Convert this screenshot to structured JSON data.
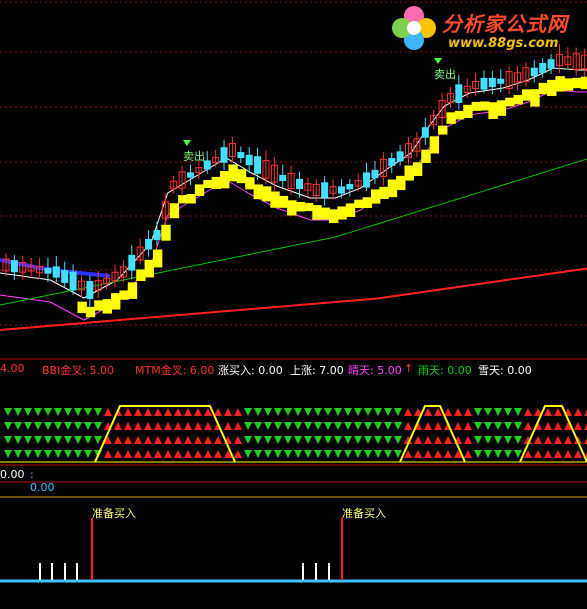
{
  "watermark": {
    "name": "分析家公式网",
    "url": "www.88gs.com"
  },
  "price_panel": {
    "signals": [
      {
        "label": "卖出"
      },
      {
        "label": "卖出"
      }
    ],
    "colors": {
      "up_candle": "#ff3030",
      "down_candle": "#40e0ff",
      "ribbon": "#ffff00",
      "ma_short": "#ffffff",
      "ma_mid": "#ff40ff",
      "ma_long": "#00c000",
      "ma_longest": "#ff2020",
      "blue_line": "#3030ff"
    }
  },
  "indicator_row": [
    {
      "text": "4.00",
      "color": "#ff3030"
    },
    {
      "text": "BBI金叉: 5.00",
      "color": "#ff3030"
    },
    {
      "text": "MTM金叉: 6.00",
      "color": "#ff3030"
    },
    {
      "text": "涨买入: 0.00",
      "color": "#ffffff"
    },
    {
      "text": "上涨: 7.00",
      "color": "#ffffff"
    },
    {
      "text": "晴天: 5.00",
      "color": "#ff40ff"
    },
    {
      "text": "↑",
      "color": "#ff3030"
    },
    {
      "text": "雨天: 0.00",
      "color": "#00d000"
    },
    {
      "text": "雪天: 0.00",
      "color": "#ffffff"
    }
  ],
  "sub_panel2": {
    "values": [
      {
        "text": "0.00",
        "color": "#ffffff"
      },
      {
        "text": ": 0.00",
        "color": "#40c0ff"
      }
    ]
  },
  "sub_panel3": {
    "markers": [
      {
        "label": "准备买入"
      },
      {
        "label": "准备买入"
      }
    ],
    "colors": {
      "baseline": "#40c0ff",
      "marker": "#ff2020",
      "label": "#ffff80"
    }
  }
}
